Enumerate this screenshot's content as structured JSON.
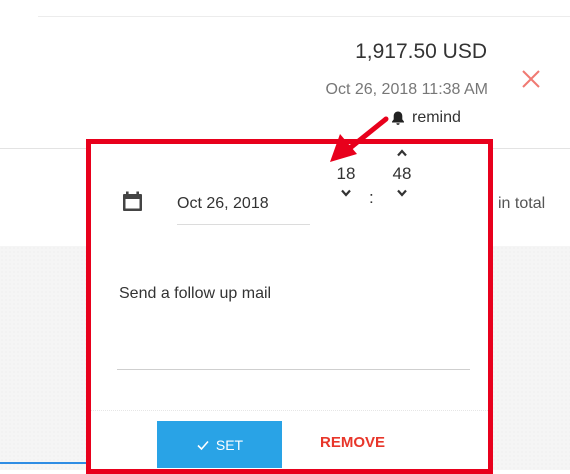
{
  "transaction": {
    "amount": "1,917.50 USD",
    "datetime": "Oct 26, 2018 11:38 AM",
    "remind_label": "remind",
    "in_total_text": "in total"
  },
  "reminder_popup": {
    "date": "Oct 26, 2018",
    "hour": "18",
    "minute": "48",
    "time_separator": ":",
    "note": "Send a follow up mail",
    "set_label": "SET",
    "remove_label": "REMOVE"
  },
  "icons": {
    "calendar": "calendar-icon",
    "bell": "bell-icon",
    "close": "close-icon",
    "check": "check-icon",
    "chevron_up": "chevron-up-icon",
    "chevron_down": "chevron-down-icon"
  },
  "colors": {
    "highlight_border": "#e8001c",
    "set_button": "#29a3e6",
    "remove_text": "#e8362a",
    "close_x": "#f07a72"
  }
}
